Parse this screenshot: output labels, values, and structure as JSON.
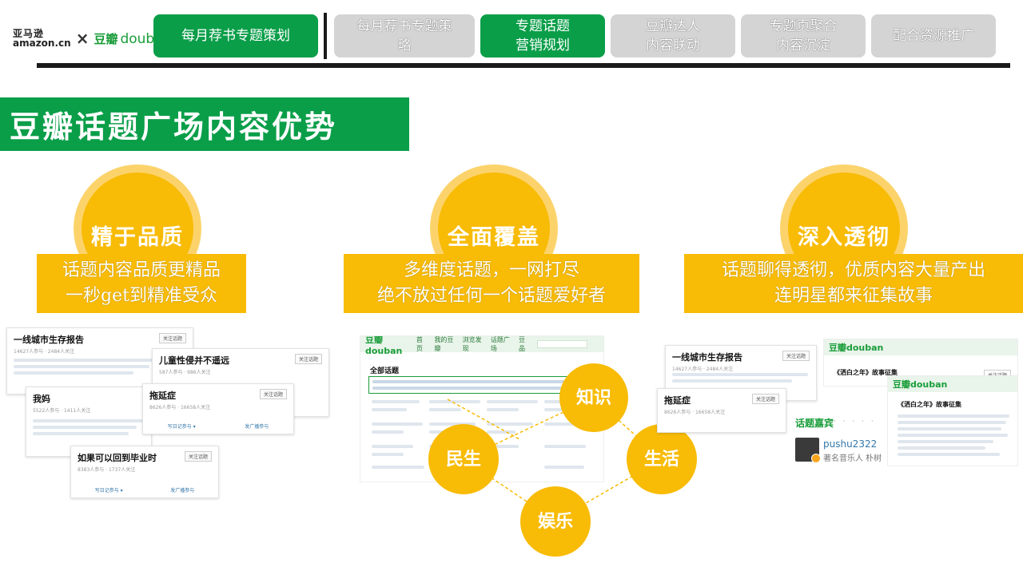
{
  "header": {
    "logo": {
      "amazon_cn": "亚马逊",
      "amazon_en": "amazon.cn",
      "separator": "×",
      "douban_cn": "豆瓣",
      "douban_en": "douban"
    },
    "tabs": [
      {
        "label": "每月荐书专题策划",
        "active": true
      },
      {
        "label": "每月荐书专题策\n略",
        "active": false
      },
      {
        "label": "专题话题\n营销规划",
        "active": true
      },
      {
        "label": "豆瓣达人\n内容联动",
        "active": false
      },
      {
        "label": "专题页聚合\n内容沉淀",
        "active": false
      },
      {
        "label": "配合资源推广",
        "active": false
      }
    ]
  },
  "title": "豆瓣话题广场内容优势",
  "features": [
    {
      "heading": "精于品质",
      "desc_line1": "话题内容品质更精品",
      "desc_line2": "一秒get到精准受众"
    },
    {
      "heading": "全面覆盖",
      "desc_line1": "多维度话题，一网打尽",
      "desc_line2": "绝不放过任何一个话题爱好者"
    },
    {
      "heading": "深入透彻",
      "desc_line1": "话题聊得透彻，优质内容大量产出",
      "desc_line2": "连明星都来征集故事"
    }
  ],
  "topics": [
    "知识",
    "民生",
    "生活",
    "娱乐"
  ],
  "screens_left": {
    "cards": [
      {
        "title": "一线城市生存报告",
        "meta": "14627人参与 · 2484人关注",
        "button": "关注话题"
      },
      {
        "title": "儿童性侵并不遥远",
        "meta": "587人参与 · 986人关注",
        "button": "关注话题"
      },
      {
        "title": "我妈",
        "meta": "5522人参与 · 1411人关注",
        "button": ""
      },
      {
        "title": "拖延症",
        "meta": "8626人参与 · 16658人关注",
        "button": "关注话题"
      },
      {
        "title": "如果可以回到毕业时",
        "meta": "8383人参与 · 1737人关注",
        "button": "关注话题"
      }
    ],
    "actions": {
      "write": "写日记参与 ▾",
      "broadcast": "发广播参与"
    }
  },
  "screens_mid": {
    "brand": "豆瓣douban",
    "nav": [
      "首页",
      "我的豆瓣",
      "浏览发现",
      "话题广场",
      "豆品"
    ],
    "section": "全部话题"
  },
  "screens_right": {
    "brand": "豆瓣douban",
    "cards": [
      {
        "title": "一线城市生存报告",
        "meta": "14627人参与 · 2484人关注",
        "button": "关注话题"
      },
      {
        "title": "拖延症",
        "meta": "8626人参与 · 16658人关注",
        "button": "关注话题"
      },
      {
        "title": "《洒白之年》故事征集",
        "meta": "",
        "button": "关注话题"
      }
    ],
    "guest_section": "话题嘉宾",
    "guest_name": "pushu2322",
    "guest_role": "著名音乐人 朴树"
  },
  "colors": {
    "green": "#0a9e49",
    "yellow": "#f8bb06",
    "light_yellow": "#fcd36b",
    "grey_tab": "#d4d4d4",
    "dark": "#1a1a1a"
  }
}
